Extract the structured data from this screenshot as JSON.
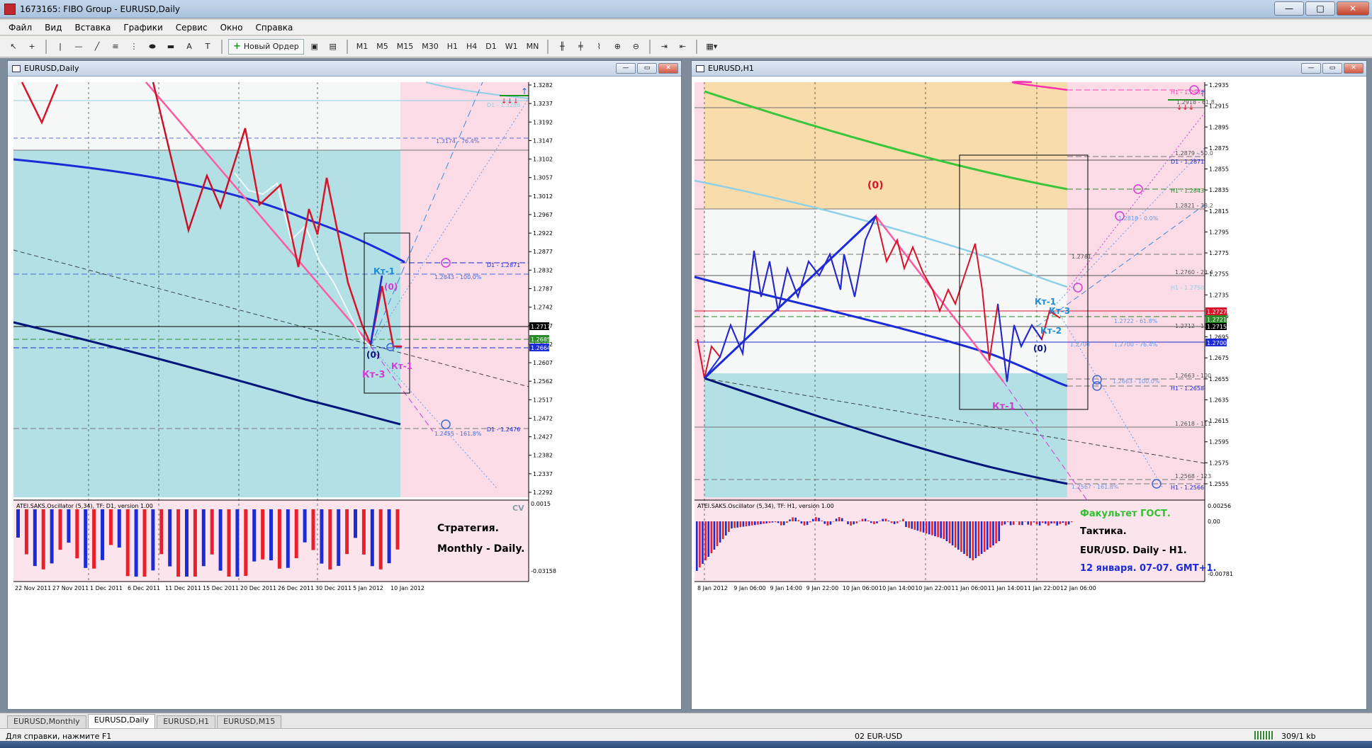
{
  "window": {
    "title": "1673165: FIBO Group - EURUSD,Daily",
    "min": "—",
    "max": "□",
    "close": "✕"
  },
  "menu": [
    "Файл",
    "Вид",
    "Вставка",
    "Графики",
    "Сервис",
    "Окно",
    "Справка"
  ],
  "toolbar": {
    "new_order": "Новый Ордер",
    "timeframes": [
      "M1",
      "M5",
      "M15",
      "M30",
      "H1",
      "H4",
      "D1",
      "W1",
      "MN"
    ]
  },
  "chart_left": {
    "title": "EURUSD,Daily",
    "price_ticks": [
      "1.3282",
      "1.3237",
      "1.3192",
      "1.3147",
      "1.3102",
      "1.3057",
      "1.3012",
      "1.2967",
      "1.2922",
      "1.2877",
      "1.2832",
      "1.2787",
      "1.2742",
      "1.2697",
      "1.2652",
      "1.2607",
      "1.2562",
      "1.2517",
      "1.2472",
      "1.2427",
      "1.2382",
      "1.2337",
      "1.2292"
    ],
    "price_tags": {
      "current": "1.2717",
      "green": "1.2685",
      "blue": "1.2664"
    },
    "dates": [
      "22 Nov 2011",
      "27 Nov 2011",
      "1 Dec 2011",
      "6 Dec 2011",
      "11 Dec 2011",
      "15 Dec 2011",
      "20 Dec 2011",
      "26 Dec 2011",
      "30 Dec 2011",
      "5 Jan 2012",
      "10 Jan 2012"
    ],
    "labels": {
      "fibo_top": "D1 - 1.3286",
      "fibo_764": "1.3174 - 76.4%",
      "d1_2871": "D1 - 1.2871",
      "fibo_100": "1.2843 - 100.0%",
      "d1_2476": "D1 - 1.2476",
      "fibo_1618": "1.2455 - 161.8%",
      "kt1_blue": "Кт-1",
      "zero_pink": "(0)",
      "zero_dark": "(0)",
      "kt1_pink": "Кт-1",
      "kt3_pink": "Кт-3"
    },
    "osc": {
      "title": "ATEI.SAKS.Oscillator (5,34), TF: D1, version 1.00",
      "cv": "CV",
      "top_val": "0.0015",
      "bottom_val": "-0.03158",
      "text1": "Стратегия.",
      "text2": "Monthly - Daily."
    }
  },
  "chart_right": {
    "title": "EURUSD,H1",
    "price_ticks": [
      "1.2935",
      "1.2915",
      "1.2895",
      "1.2875",
      "1.2855",
      "1.2835",
      "1.2815",
      "1.2795",
      "1.2775",
      "1.2755",
      "1.2735",
      "1.2715",
      "1.2695",
      "1.2675",
      "1.2655",
      "1.2635",
      "1.2615",
      "1.2595",
      "1.2575",
      "1.2555"
    ],
    "price_tags": {
      "red": "1.2727",
      "green": "1.2721",
      "current": "1.2715",
      "blue": "1.2700"
    },
    "dates": [
      "8 Jan 2012",
      "9 Jan 06:00",
      "9 Jan 14:00",
      "9 Jan 22:00",
      "10 Jan 06:00",
      "10 Jan 14:00",
      "10 Jan 22:00",
      "11 Jan 06:00",
      "11 Jan 14:00",
      "11 Jan 22:00",
      "12 Jan 06:00"
    ],
    "labels": {
      "h1_top": "H1 - 1.2932",
      "fib_618_top": "1.2918 - 61.8",
      "fib_50": "1.2879 - 50.0",
      "d1_2871": "D1 - 1.2871",
      "h1_2843": "H1 - 1.2843",
      "fib_382": "1.2821 - 38.2",
      "fib_00": "1.2818 - 0.0%",
      "fib_2781": "1.2781",
      "fib_236": "1.2760 - 23.4",
      "h1_2750": "H1 - 1.2750",
      "fib_618": "1.2722 - 61.8%",
      "fib_118": "1.2712 - 11.8",
      "fib_2700": "1.2700",
      "fib_764": "1.2700 - 76.4%",
      "fib_2663": "1.2663 - 100",
      "fib_100": "1.2663 - 100.0%",
      "h1_2658": "H1 - 1.2658",
      "fib_111": "1.2618 - 111",
      "fib_123": "1.2568 - 123",
      "fib_1618": "1.2567 - 161.8%",
      "h1_2566": "H1 - 1.2566",
      "zero_red": "(0)",
      "zero_dark": "(0)",
      "kt1_blue": "Кт-1",
      "kt3_blue": "Кт-3",
      "kt2_blue": "Кт-2",
      "kt1_pink": "Кт-1"
    },
    "osc": {
      "title": "ATEI.SAKS.Oscillator (5,34), TF: H1, version 1.00",
      "top_val": "0.00256",
      "mid_val": "0.00",
      "bottom_val": "-0.00781",
      "t1": "Факультет ГОСТ.",
      "t2": "Тактика.",
      "t3": "EUR/USD. Daily - H1.",
      "t4": "12 января. 07-07. GMT+1."
    }
  },
  "tabs": [
    "EURUSD,Monthly",
    "EURUSD,Daily",
    "EURUSD,H1",
    "EURUSD,M15"
  ],
  "status": {
    "help": "Для справки, нажмите F1",
    "profile": "02 EUR-USD",
    "traffic": "309/1 kb"
  },
  "colors": {
    "pink_zone": "#fadbe6",
    "cyan_zone": "#b3e0e4",
    "orange_zone": "#f9dcac",
    "navy": "#00147a",
    "blue": "#1b2bd6",
    "red_line": "#d8142a",
    "pink_line": "#ff5aa0"
  }
}
